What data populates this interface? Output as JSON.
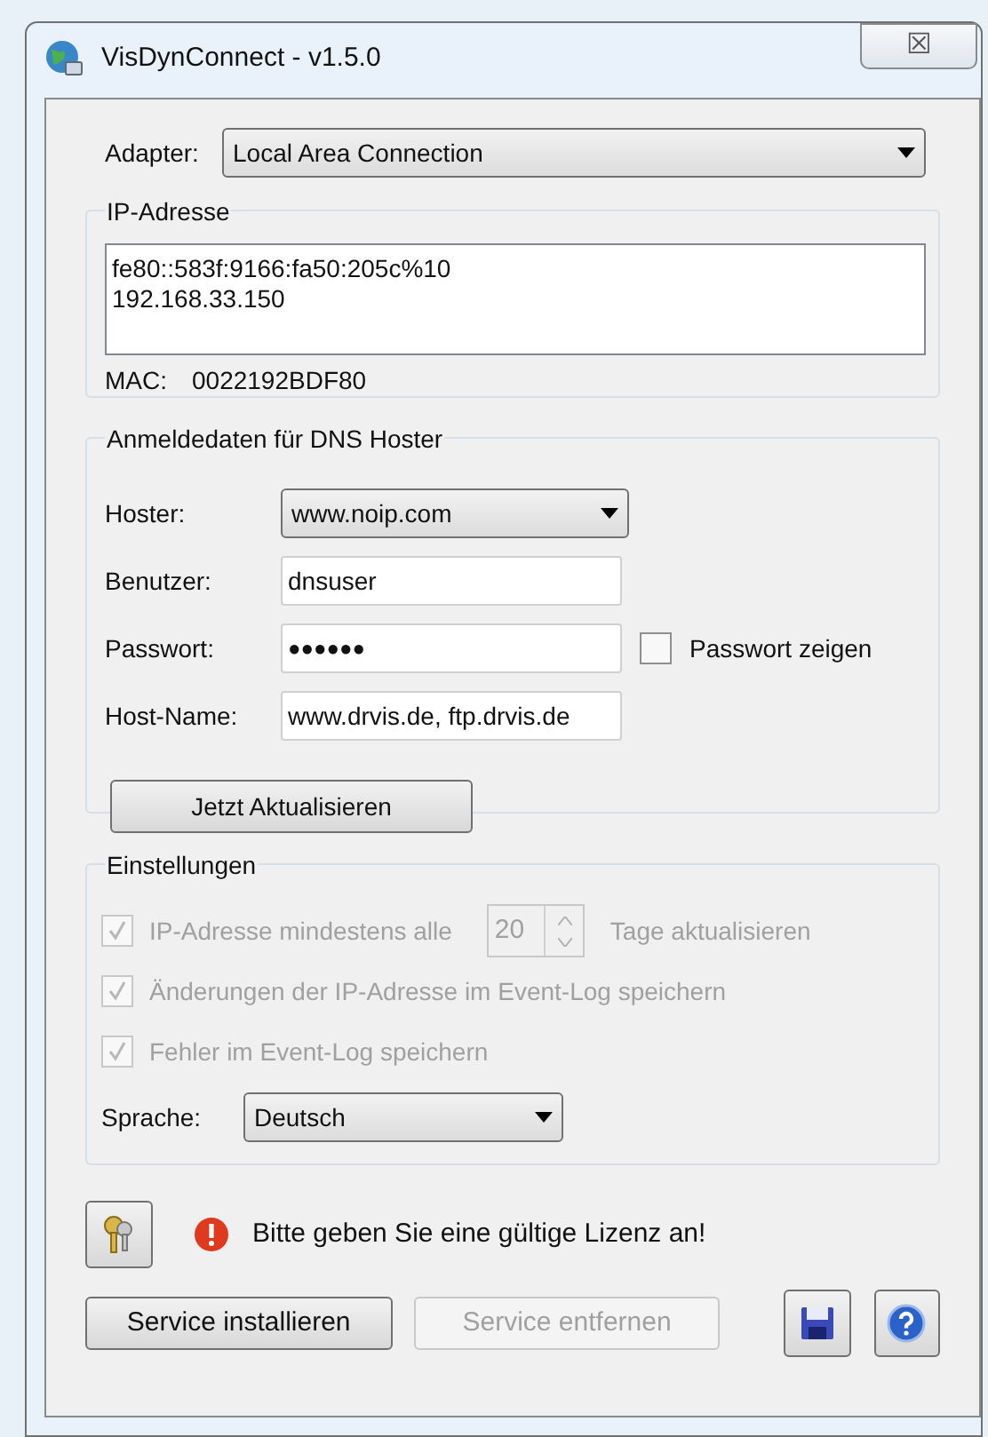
{
  "window": {
    "title": "VisDynConnect - v1.5.0",
    "close": "☒"
  },
  "adapter": {
    "label": "Adapter:",
    "value": "Local Area Connection"
  },
  "ip_group": {
    "title": "IP-Adresse",
    "addresses": [
      "fe80::583f:9166:fa50:205c%10",
      "192.168.33.150"
    ],
    "mac_label": "MAC:",
    "mac": "0022192BDF80"
  },
  "dns_group": {
    "title": "Anmeldedaten für DNS Hoster",
    "fields": [
      {
        "kind": "combo",
        "label": "Hoster:",
        "value": "www.noip.com"
      },
      {
        "kind": "text",
        "label": "Benutzer:",
        "value": "dnsuser"
      },
      {
        "kind": "password",
        "label": "Passwort:",
        "value": "●●●●●●",
        "toggle": {
          "label": "Passwort zeigen",
          "checked": false
        }
      },
      {
        "kind": "text",
        "label": "Host-Name:",
        "value": "www.drvis.de, ftp.drvis.de"
      }
    ],
    "button": "Jetzt Aktualisieren"
  },
  "settings": {
    "title": "Einstellungen",
    "options": [
      {
        "label": "IP-Adresse mindestens alle",
        "checked": true,
        "disabled": true,
        "spinner": {
          "value": "20",
          "suffix": "Tage aktualisieren"
        }
      },
      {
        "label": "Änderungen der IP-Adresse im Event-Log speichern",
        "checked": true,
        "disabled": true
      },
      {
        "label": "Fehler im Event-Log speichern",
        "checked": true,
        "disabled": true
      }
    ],
    "language": {
      "label": "Sprache:",
      "value": "Deutsch"
    }
  },
  "license": {
    "message": "Bitte geben Sie eine gültige Lizenz an!"
  },
  "buttons": [
    {
      "label": "Service installieren",
      "disabled": false
    },
    {
      "label": "Service entfernen",
      "disabled": true
    }
  ]
}
